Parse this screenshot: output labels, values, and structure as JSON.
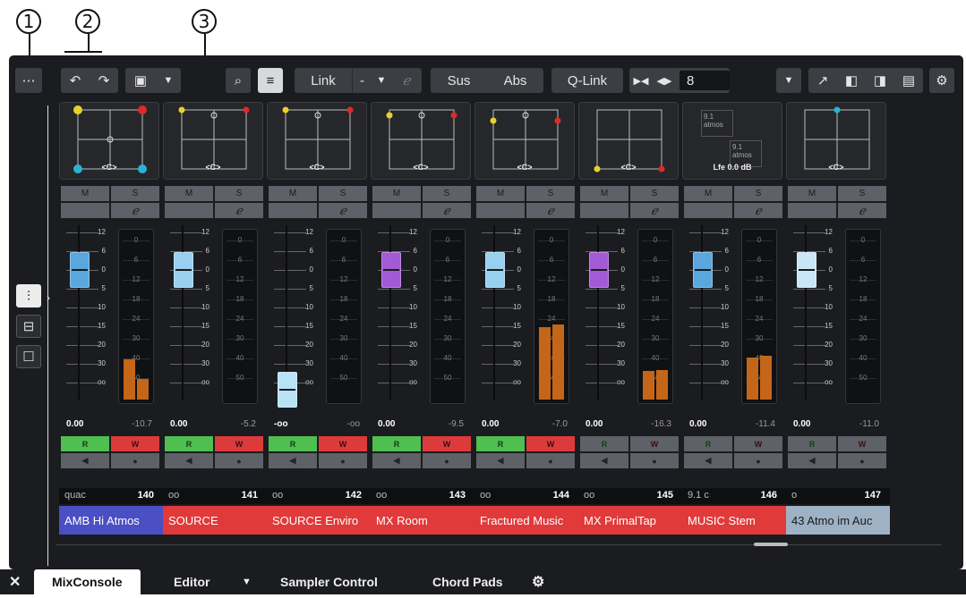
{
  "callouts": [
    "1",
    "2",
    "3"
  ],
  "toolbar": {
    "link": "Link",
    "link_value": "-",
    "sus": "Sus",
    "abs": "Abs",
    "qlink": "Q-Link",
    "channel_count": "8"
  },
  "left_tools": [
    "mixer-icon",
    "routing-icon",
    "rack-icon"
  ],
  "strips": [
    {
      "panner_tag": "<C>",
      "m": "M",
      "s": "S",
      "fader": "0.00",
      "peak": "-10.7",
      "r": "R",
      "w": "W",
      "label_type": "quac",
      "number": "140",
      "name": "AMB Hi Atmos",
      "name_color": "#4b4fc4",
      "cap_color": "#5aa7dd",
      "meter_level": 0.25,
      "record_on": true
    },
    {
      "panner_tag": "<C>",
      "m": "M",
      "s": "S",
      "fader": "0.00",
      "peak": "-5.2",
      "r": "R",
      "w": "W",
      "label_type": "oo",
      "number": "141",
      "name": "SOURCE",
      "name_color": "#e03a3a",
      "cap_color": "#9ad0ef",
      "meter_level": 0,
      "record_on": true
    },
    {
      "panner_tag": "<C>",
      "m": "M",
      "s": "S",
      "fader": "-oo",
      "peak": "-oo",
      "r": "R",
      "w": "W",
      "label_type": "oo",
      "number": "142",
      "name": "SOURCE Enviro",
      "name_color": "#e03a3a",
      "cap_color": "#b8e3f7",
      "meter_level": 0,
      "record_on": true
    },
    {
      "panner_tag": "<C>",
      "m": "M",
      "s": "S",
      "fader": "0.00",
      "peak": "-9.5",
      "r": "R",
      "w": "W",
      "label_type": "oo",
      "number": "143",
      "name": "MX Room",
      "name_color": "#e03a3a",
      "cap_color": "#a35ad6",
      "meter_level": 0,
      "record_on": true
    },
    {
      "panner_tag": "<C>",
      "m": "M",
      "s": "S",
      "fader": "0.00",
      "peak": "-7.0",
      "r": "R",
      "w": "W",
      "label_type": "oo",
      "number": "144",
      "name": "Fractured Music",
      "name_color": "#e03a3a",
      "cap_color": "#9ad0ef",
      "meter_level": 0.45,
      "record_on": true
    },
    {
      "panner_tag": "<C>",
      "m": "M",
      "s": "S",
      "fader": "0.00",
      "peak": "-16.3",
      "r": "R",
      "w": "W",
      "label_type": "oo",
      "number": "145",
      "name": "MX PrimalTap",
      "name_color": "#e03a3a",
      "cap_color": "#a35ad6",
      "meter_level": 0.18,
      "record_on": false
    },
    {
      "panner_tag": "Lfe 0.0 dB",
      "m": "M",
      "s": "S",
      "fader": "0.00",
      "peak": "-11.4",
      "r": "R",
      "w": "W",
      "label_type": "9.1 c",
      "number": "146",
      "name": "MUSIC Stem",
      "name_color": "#e03a3a",
      "cap_color": "#5aa7dd",
      "meter_level": 0.26,
      "record_on": false
    },
    {
      "panner_tag": "<C>",
      "m": "M",
      "s": "S",
      "fader": "0.00",
      "peak": "-11.0",
      "r": "R",
      "w": "W",
      "label_type": "o",
      "number": "147",
      "name": "43 Atmo im Auc",
      "name_color": "#9fb2c5",
      "cap_color": "#c9e6f7",
      "meter_level": 0,
      "record_on": false
    }
  ],
  "scale_left": [
    "12",
    "6",
    "0",
    "5",
    "10",
    "15",
    "20",
    "30",
    "oo"
  ],
  "scale_meter": [
    "0",
    "6",
    "12",
    "18",
    "24",
    "30",
    "40",
    "50"
  ],
  "atmos": {
    "top": "9.1",
    "top_sub": "atmos",
    "bottom": "9.1",
    "bottom_sub": "atmos"
  },
  "tabs": {
    "mixconsole": "MixConsole",
    "editor": "Editor",
    "sampler": "Sampler Control",
    "chordpads": "Chord Pads"
  }
}
